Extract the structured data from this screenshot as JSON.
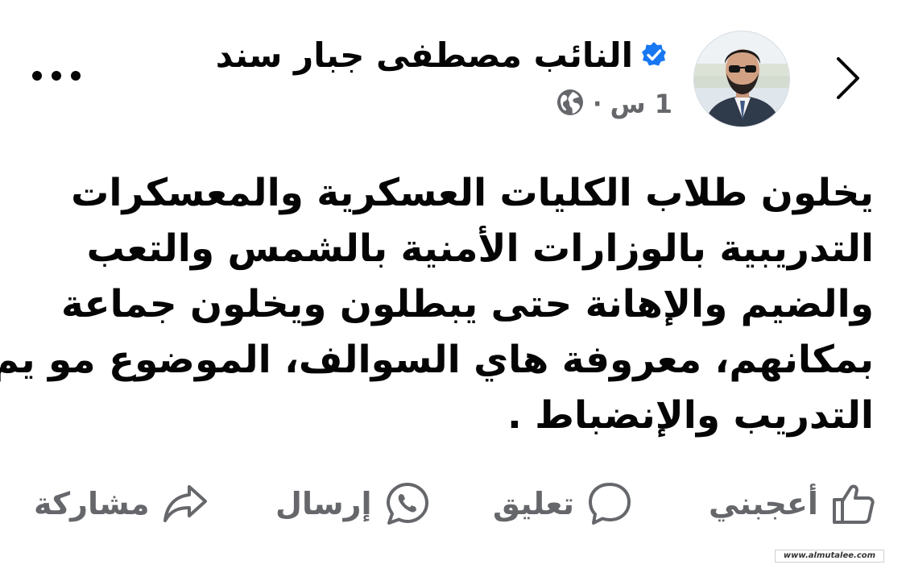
{
  "header": {
    "author_name": "النائب  مصطفى  جبار سند",
    "verified_icon": "verified-badge-icon",
    "time": "1 س",
    "separator": "·",
    "audience_icon": "globe-icon",
    "back_icon": "chevron-right-icon",
    "more_icon": "more-options-icon"
  },
  "post": {
    "lines": [
      "يخلون طلاب الكليات العسكرية والمعسكرات",
      "التدريبية بالوزارات الأمنية بالشمس والتعب",
      "والضيم والإهانة حتى يبطلون ويخلون جماعة",
      "بمكانهم، معروفة هاي السوالف، الموضوع مو يم",
      "التدريب والإنضباط ."
    ]
  },
  "actions": {
    "like": {
      "label": "أعجبني",
      "icon": "thumbs-up-icon"
    },
    "comment": {
      "label": "تعليق",
      "icon": "comment-bubble-icon"
    },
    "send": {
      "label": "إرسال",
      "icon": "whatsapp-icon"
    },
    "share": {
      "label": "مشاركة",
      "icon": "share-arrow-icon"
    }
  },
  "watermark": "www.almutalee.com",
  "colors": {
    "text_primary": "#050505",
    "text_secondary": "#65676b",
    "verified_blue": "#1877f2",
    "background": "#ffffff"
  }
}
